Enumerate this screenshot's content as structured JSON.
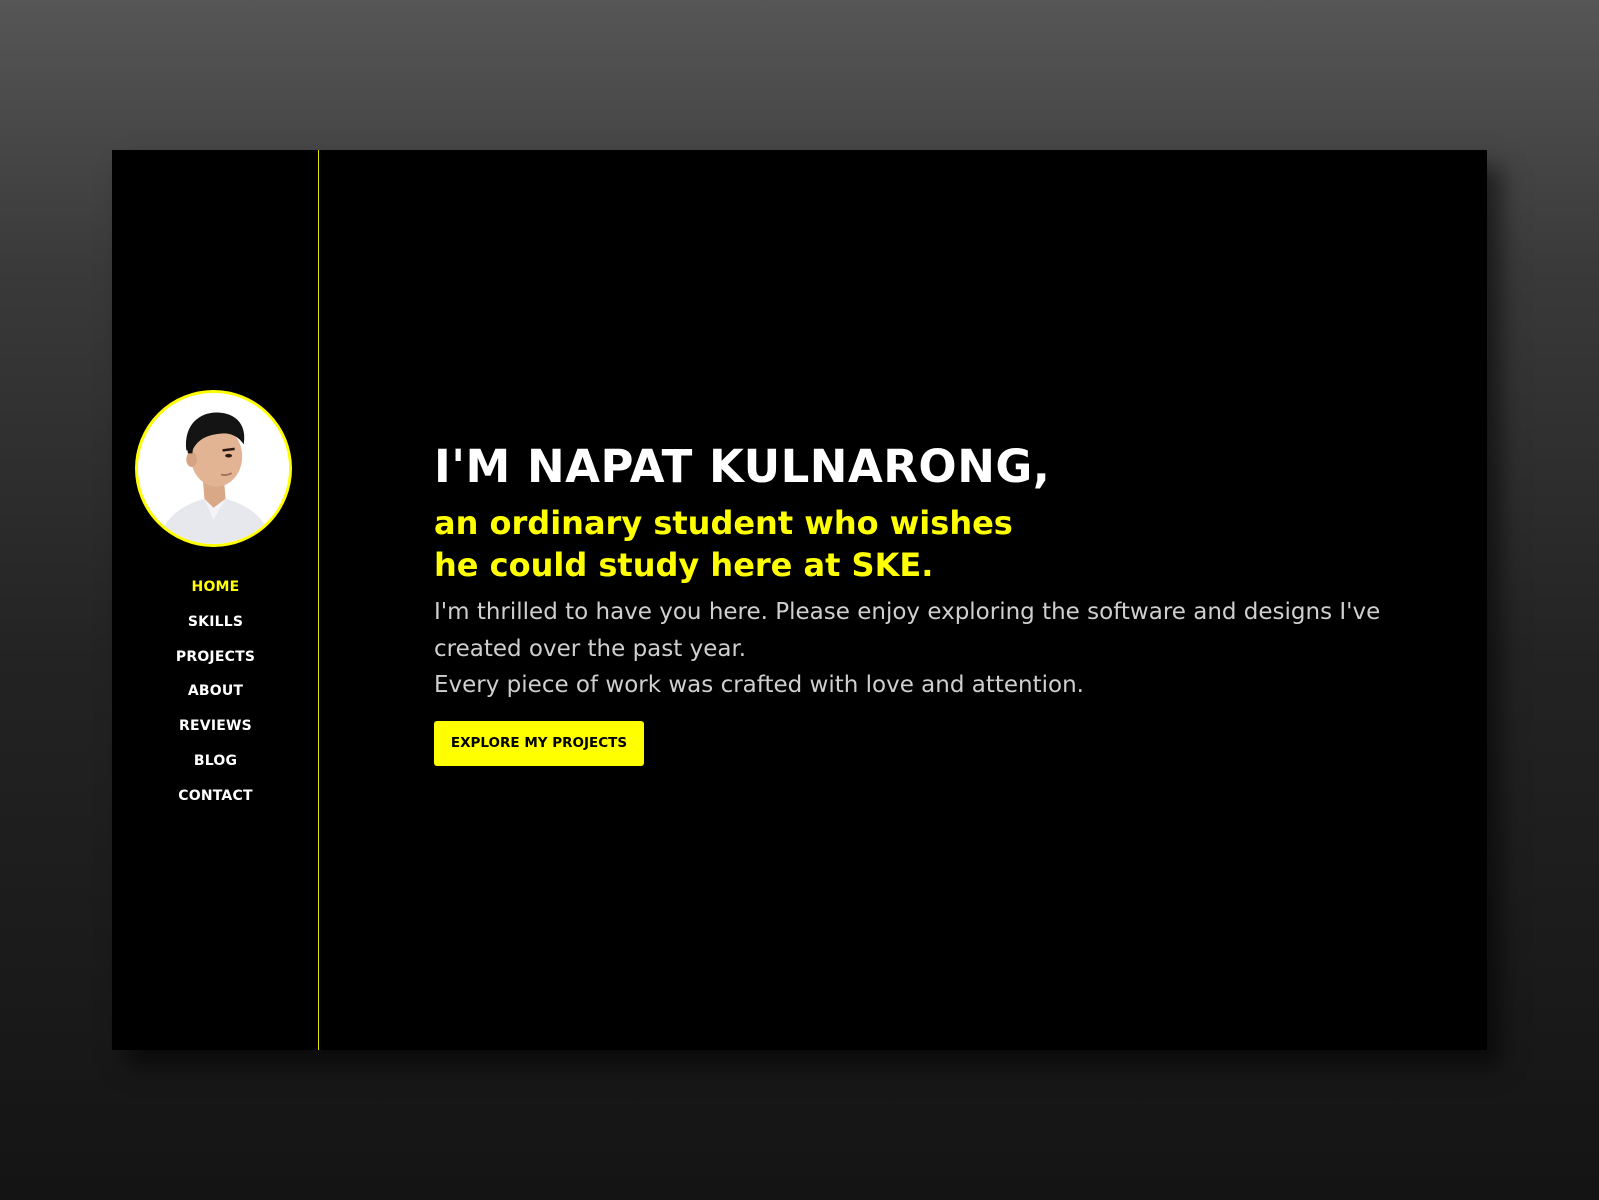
{
  "colors": {
    "accent": "#ffff00",
    "background": "#000000",
    "text": "#ffffff",
    "muted_text": "#cfcfcf"
  },
  "sidebar": {
    "avatar_icon": "profile-photo",
    "nav_items": [
      {
        "label": "HOME",
        "active": true
      },
      {
        "label": "SKILLS",
        "active": false
      },
      {
        "label": "PROJECTS",
        "active": false
      },
      {
        "label": "ABOUT",
        "active": false
      },
      {
        "label": "REVIEWS",
        "active": false
      },
      {
        "label": "BLOG",
        "active": false
      },
      {
        "label": "CONTACT",
        "active": false
      }
    ]
  },
  "hero": {
    "title": "I'M NAPAT KULNARONG,",
    "subtitle_line1": "an ordinary student who wishes",
    "subtitle_line2": "he could study here at SKE.",
    "desc_line1": "I'm thrilled to have you here. Please enjoy exploring the software and designs I've",
    "desc_line2": "created over the past year.",
    "desc_line3": "Every piece of work was crafted with love and attention.",
    "cta_label": "EXPLORE MY PROJECTS"
  }
}
